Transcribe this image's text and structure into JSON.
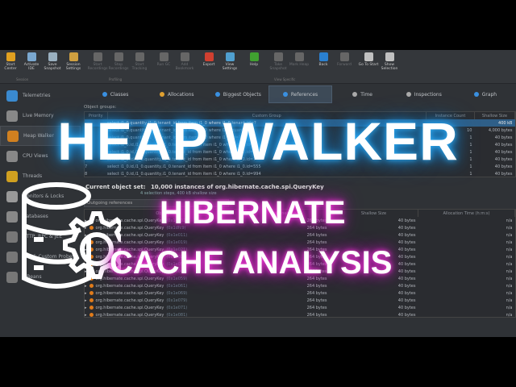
{
  "toolbar": {
    "buttons": [
      {
        "label": "Start Center",
        "icon": "folder-icon",
        "color": "#e0a020",
        "enabled": true
      },
      {
        "label": "Activate IDE",
        "icon": "ide-icon",
        "color": "#7aa8d0",
        "enabled": true
      },
      {
        "label": "Save Snapshot",
        "icon": "save-icon",
        "color": "#9ab0c0",
        "enabled": true
      },
      {
        "label": "Session Settings",
        "icon": "settings-icon",
        "color": "#d0a040",
        "enabled": true
      },
      {
        "label": "Start Recordings",
        "icon": "record-icon",
        "color": "#666",
        "enabled": false
      },
      {
        "label": "Stop Recordings",
        "icon": "stop-icon",
        "color": "#666",
        "enabled": false
      },
      {
        "label": "Start Tracking",
        "icon": "tracking-icon",
        "color": "#666",
        "enabled": false
      },
      {
        "label": "Run GC",
        "icon": "gc-icon",
        "color": "#666",
        "enabled": false
      },
      {
        "label": "Add Bookmark",
        "icon": "bookmark-icon",
        "color": "#666",
        "enabled": false
      },
      {
        "label": "Export",
        "icon": "export-icon",
        "color": "#d04030",
        "enabled": true
      },
      {
        "label": "View Settings",
        "icon": "view-settings-icon",
        "color": "#50a0d0",
        "enabled": true
      },
      {
        "label": "Help",
        "icon": "help-icon",
        "color": "#40a030",
        "enabled": true
      },
      {
        "label": "Take Snapshot",
        "icon": "camera-icon",
        "color": "#666",
        "enabled": false
      },
      {
        "label": "Mark Heap",
        "icon": "pin-icon",
        "color": "#666",
        "enabled": false
      },
      {
        "label": "Back",
        "icon": "back-icon",
        "color": "#2a80d0",
        "enabled": true
      },
      {
        "label": "Forward",
        "icon": "forward-icon",
        "color": "#666",
        "enabled": false
      },
      {
        "label": "Go To Start",
        "icon": "home-icon",
        "color": "#c0c0c0",
        "enabled": true
      },
      {
        "label": "Show Selection",
        "icon": "selection-icon",
        "color": "#c0c0c0",
        "enabled": true
      }
    ],
    "groups": [
      "Session",
      "Profiling",
      "View Specific"
    ]
  },
  "sidebar": {
    "items": [
      {
        "label": "Telemetries",
        "color": "#3a8ad0"
      },
      {
        "label": "Live Memory",
        "color": "#888"
      },
      {
        "label": "Heap Walker",
        "color": "#d08020",
        "active": true
      },
      {
        "label": "CPU Views",
        "color": "#888"
      },
      {
        "label": "Threads",
        "color": "#d0a020"
      },
      {
        "label": "Monitors & Locks",
        "color": "#999"
      },
      {
        "label": "Databases",
        "color": "#888"
      },
      {
        "label": "HTTP, RPC & JEE",
        "color": "#777"
      },
      {
        "label": "JVM & Custom Probes",
        "color": "#777"
      },
      {
        "label": "MBeans",
        "color": "#777"
      }
    ]
  },
  "tabs": [
    {
      "label": "Classes",
      "color": "#3a90e0"
    },
    {
      "label": "Allocations",
      "color": "#e0a030"
    },
    {
      "label": "Biggest Objects",
      "color": "#3a90e0"
    },
    {
      "label": "References",
      "color": "#3a90e0",
      "active": true
    },
    {
      "label": "Time",
      "color": "#aaa"
    },
    {
      "label": "Inspections",
      "color": "#aaa"
    },
    {
      "label": "Graph",
      "color": "#3a90e0"
    }
  ],
  "groups": {
    "label": "Object groups:",
    "columns": [
      "Priority",
      "Custom Group",
      "Instance Count",
      "Shallow Size"
    ],
    "rows": [
      [
        "",
        "select i1_0.quantity,i1_0.tenant_id from item i1_0 where i1_0.tenant_id=?",
        "",
        "400 kB"
      ],
      [
        "",
        "select i1_0.quantity,i1_0.tenant_id from item i1_0 where i1_0.quantity=?",
        "10",
        "4,000 bytes"
      ],
      [
        "",
        "select i1_0.quantity,i1_0.tenant_id from item i1_0 where i1_0.id=?",
        "1",
        "40 bytes"
      ],
      [
        "",
        "select i1_0.id,i1_0.quantity,i1_0.tenant_id from item i1_0 where i1_0.id=?",
        "1",
        "40 bytes"
      ],
      [
        "",
        "select i1_0.id,i1_0.quantity,i1_0.tenant_id from item i1_0 where i1_0.id=?",
        "1",
        "40 bytes"
      ],
      [
        "",
        "select i1_0.id,i1_0.quantity,i1_0.tenant_id from item i1_0 where i1_0.id=?",
        "1",
        "40 bytes"
      ],
      [
        "7",
        "select i1_0.id,i1_0.quantity,i1_0.tenant_id from item i1_0 where i1_0.id=555",
        "1",
        "40 bytes"
      ],
      [
        "8",
        "select i1_0.id,i1_0.quantity,i1_0.tenant_id from item i1_0 where i1_0.id=994",
        "1",
        "40 bytes"
      ]
    ]
  },
  "current": {
    "label": "Current object set:",
    "value": "10,000 instances of org.hibernate.cache.spi.QueryKey",
    "steps": "4 selection steps, 400 kB shallow size"
  },
  "refs": {
    "dropdown": "Outgoing references",
    "columns": [
      "Object",
      "Retained Size",
      "Shallow Size",
      "Allocation Time (h:m:s)"
    ],
    "rows": [
      [
        "org.hibernate.cache.spi.QueryKey",
        "(0x1e002)",
        "264 bytes",
        "40 bytes",
        "n/a"
      ],
      [
        "org.hibernate.cache.spi.QueryKey",
        "(0x1dfc9)",
        "264 bytes",
        "40 bytes",
        "n/a"
      ],
      [
        "org.hibernate.cache.spi.QueryKey",
        "(0x1e011)",
        "264 bytes",
        "40 bytes",
        "n/a"
      ],
      [
        "org.hibernate.cache.spi.QueryKey",
        "(0x1e019)",
        "264 bytes",
        "40 bytes",
        "n/a"
      ],
      [
        "org.hibernate.cache.spi.QueryKey",
        "(0x1e021)",
        "264 bytes",
        "40 bytes",
        "n/a"
      ],
      [
        "org.hibernate.cache.spi.QueryKey",
        "(0x1e029)",
        "264 bytes",
        "40 bytes",
        "n/a"
      ],
      [
        "org.hibernate.cache.spi.QueryKey",
        "(0x1e051)",
        "264 bytes",
        "40 bytes",
        "n/a"
      ],
      [
        "org.hibernate.cache.spi.QueryKey",
        "(0x1e049)",
        "264 bytes",
        "40 bytes",
        "n/a"
      ],
      [
        "org.hibernate.cache.spi.QueryKey",
        "(0x1e059)",
        "264 bytes",
        "40 bytes",
        "n/a"
      ],
      [
        "org.hibernate.cache.spi.QueryKey",
        "(0x1e061)",
        "264 bytes",
        "40 bytes",
        "n/a"
      ],
      [
        "org.hibernate.cache.spi.QueryKey",
        "(0x1e069)",
        "264 bytes",
        "40 bytes",
        "n/a"
      ],
      [
        "org.hibernate.cache.spi.QueryKey",
        "(0x1e079)",
        "264 bytes",
        "40 bytes",
        "n/a"
      ],
      [
        "org.hibernate.cache.spi.QueryKey",
        "(0x1e071)",
        "264 bytes",
        "40 bytes",
        "n/a"
      ],
      [
        "org.hibernate.cache.spi.QueryKey",
        "(0x1e081)",
        "264 bytes",
        "40 bytes",
        "n/a"
      ]
    ]
  },
  "overlay": {
    "title": "HEAP WALKER",
    "line1": "HIBERNATE",
    "line2": "CACHE ANALYSIS"
  }
}
